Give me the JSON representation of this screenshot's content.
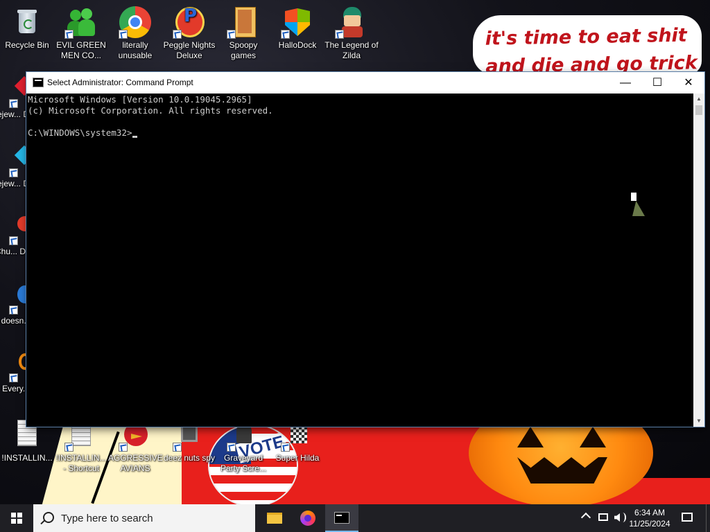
{
  "wallpaper": {
    "speech_text": "it's time to eat shit and die and go trick",
    "vote_text": "VOTE"
  },
  "desktop_icons": [
    {
      "label": "Recycle Bin"
    },
    {
      "label": "EVIL GREEN MEN CO..."
    },
    {
      "label": "literally unusable"
    },
    {
      "label": "Peggle Nights Deluxe"
    },
    {
      "label": "Spoopy games"
    },
    {
      "label": "HalloDock"
    },
    {
      "label": "The Legend of Zilda"
    },
    {
      "label": "Bejew... Delu"
    },
    {
      "label": "Bejew... Delu"
    },
    {
      "label": "Chu... Delu"
    },
    {
      "label": "doesn..."
    },
    {
      "label": "Every..."
    },
    {
      "label": "!INSTALLIN..."
    },
    {
      "label": "!INSTALLIN... - Shortcut"
    },
    {
      "label": "AGGRESSIVE AVIANS"
    },
    {
      "label": "deez nuts spy"
    },
    {
      "label": "Graveyard Party Scre..."
    },
    {
      "label": "Super Hilda"
    }
  ],
  "cmd_window": {
    "title": "Select Administrator: Command Prompt",
    "lines": [
      "Microsoft Windows [Version 10.0.19045.2965]",
      "(c) Microsoft Corporation. All rights reserved.",
      "",
      "C:\\WINDOWS\\system32>"
    ],
    "minimize": "—",
    "maximize": "☐",
    "close": "✕"
  },
  "taskbar": {
    "search_placeholder": "Type here to search",
    "time": "6:34 AM",
    "date": "11/25/2024"
  }
}
